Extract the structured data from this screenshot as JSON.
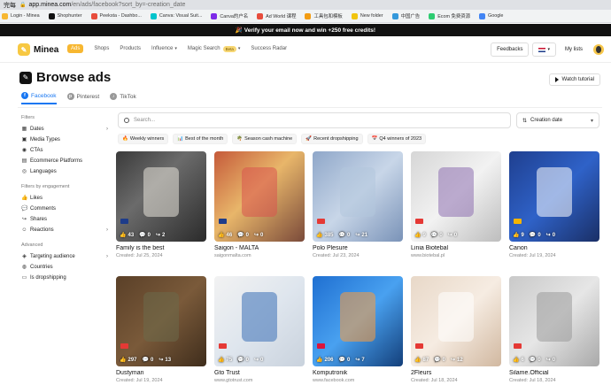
{
  "browser": {
    "tab_fragment": "完每",
    "url_host": "app.minea.com",
    "url_path": "/en/ads/facebook?sort_by=-creation_date",
    "bookmarks": [
      {
        "label": "Login - Minea",
        "color": "#f7b731"
      },
      {
        "label": "Shophunter",
        "color": "#111111"
      },
      {
        "label": "Peeksta - Dashbo...",
        "color": "#e74c3c"
      },
      {
        "label": "Canva: Visual Suit...",
        "color": "#00c4cc"
      },
      {
        "label": "Canva的户名",
        "color": "#7d2ae8"
      },
      {
        "label": "Ad World 课程",
        "color": "#e74c3c"
      },
      {
        "label": "工具包和模板",
        "color": "#f39c12"
      },
      {
        "label": "New folder",
        "color": "#f1c40f"
      },
      {
        "label": "中国广告",
        "color": "#3498db"
      },
      {
        "label": "Ecom 免费资源",
        "color": "#2ecc71"
      },
      {
        "label": "Google",
        "color": "#4285f4"
      }
    ]
  },
  "banner": {
    "text": "🎉 Verify your email now and win +250 free credits!"
  },
  "header": {
    "logo": "Minea",
    "nav": [
      {
        "label": "Ads",
        "active": true
      },
      {
        "label": "Shops"
      },
      {
        "label": "Products"
      },
      {
        "label": "Influence",
        "chevron": true
      },
      {
        "label": "Magic Search",
        "badge": "Beta",
        "chevron": true
      },
      {
        "label": "Success Radar"
      }
    ],
    "feedbacks": "Feedbacks",
    "my_lists": "My lists"
  },
  "page": {
    "title": "Browse ads",
    "watch_tutorial": "Watch tutorial",
    "tabs": [
      {
        "label": "Facebook",
        "active": true,
        "color": "#1877f2",
        "glyph": "f"
      },
      {
        "label": "Pinterest",
        "color": "#999999",
        "glyph": "p"
      },
      {
        "label": "TikTok",
        "color": "#999999",
        "glyph": "♪"
      }
    ]
  },
  "sidebar": {
    "filters_head": "Filters",
    "filters": [
      {
        "label": "Dates",
        "icon": "▦",
        "arrow": true
      },
      {
        "label": "Media Types",
        "icon": "▣"
      },
      {
        "label": "CTAs",
        "icon": "◉"
      },
      {
        "label": "Ecommerce Platforms",
        "icon": "▤"
      },
      {
        "label": "Languages",
        "icon": "◎"
      }
    ],
    "engagement_head": "Filters by engagement",
    "engagement": [
      {
        "label": "Likes",
        "icon": "👍"
      },
      {
        "label": "Comments",
        "icon": "💬"
      },
      {
        "label": "Shares",
        "icon": "↪"
      },
      {
        "label": "Reactions",
        "icon": "☺",
        "arrow": true
      }
    ],
    "advanced_head": "Advanced",
    "advanced": [
      {
        "label": "Targeting audience",
        "icon": "◈",
        "arrow": true
      },
      {
        "label": "Countries",
        "icon": "◍"
      },
      {
        "label": "Is dropshipping",
        "icon": "▭"
      }
    ]
  },
  "search": {
    "placeholder": "Search..."
  },
  "sort": {
    "label": "Creation date"
  },
  "chips": [
    {
      "label": "Weekly winners",
      "icon": "🔥"
    },
    {
      "label": "Best of the month",
      "icon": "📊"
    },
    {
      "label": "Season cash machine",
      "icon": "🌴"
    },
    {
      "label": "Recent dropshipping",
      "icon": "🚀"
    },
    {
      "label": "Q4 winners of 2023",
      "icon": "📅"
    }
  ],
  "cards": [
    {
      "title": "Family is the best",
      "sub": "Created: Jul 25, 2024",
      "likes": "43",
      "comments": "0",
      "shares": "2",
      "bg": "linear-gradient(135deg,#3a3a3a,#6b6b6b 40%,#2b2b2b)",
      "accent": "#e8e4da",
      "badge": "us"
    },
    {
      "title": "Saigon - MALTA",
      "sub": "saigonmalta.com",
      "likes": "46",
      "comments": "0",
      "shares": "0",
      "bg": "linear-gradient(135deg,#c55a3a,#e8b66a 45%,#7a4a3a)",
      "accent": "#d9534f",
      "badge": "us"
    },
    {
      "title": "Polo Plesure",
      "sub": "Created: Jul 23, 2024",
      "likes": "385",
      "comments": "0",
      "shares": "21",
      "bg": "linear-gradient(135deg,#8fa7c9,#c8d6e8 50%,#7a93b8)",
      "accent": "#b3c6dd",
      "badge": "yt"
    },
    {
      "title": "Linia Biotebal",
      "sub": "www.biotebal.pl",
      "likes": "9",
      "comments": "0",
      "shares": "0",
      "bg": "linear-gradient(135deg,#d6d6d6,#f2f2f2 50%,#bdbdbd)",
      "accent": "#8e6fb0",
      "badge": "yt"
    },
    {
      "title": "Canon",
      "sub": "Created: Jul 19, 2024",
      "likes": "9",
      "comments": "0",
      "shares": "0",
      "bg": "linear-gradient(135deg,#1f3f8f,#2f62c8 50%,#1a2f66)",
      "accent": "#ffffff",
      "badge": "es"
    },
    {
      "title": "Dustyman",
      "sub": "Created: Jul 19, 2024",
      "likes": "297",
      "comments": "0",
      "shares": "13",
      "bg": "linear-gradient(135deg,#5a4028,#7a5a3a 50%,#3f2d1c)",
      "accent": "#6b6a4a",
      "badge": "yt"
    },
    {
      "title": "Gto Trust",
      "sub": "www.gtotrust.com",
      "likes": "75",
      "comments": "0",
      "shares": "0",
      "bg": "linear-gradient(135deg,#f2f2f2,#dfe6ee 50%,#c9d2dd)",
      "accent": "#3b6fb6",
      "badge": "yt"
    },
    {
      "title": "Komputronik",
      "sub": "www.facebook.com",
      "likes": "206",
      "comments": "0",
      "shares": "7",
      "bg": "linear-gradient(135deg,#1f6fd1,#49a1f0 50%,#133f7a)",
      "accent": "#ff9c3a",
      "badge": "pl"
    },
    {
      "title": "2Fleurs",
      "sub": "Created: Jul 18, 2024",
      "likes": "87",
      "comments": "0",
      "shares": "12",
      "bg": "linear-gradient(135deg,#e8d8c8,#f6ece2 50%,#d1b8a0)",
      "accent": "#ffffff",
      "badge": "yt"
    },
    {
      "title": "Silame.Official",
      "sub": "Created: Jul 18, 2024",
      "likes": "6",
      "comments": "0",
      "shares": "0",
      "bg": "linear-gradient(135deg,#c9c9c9,#e6e6e6 50%,#a9a9a9)",
      "accent": "#9a9a9a",
      "badge": "yt"
    }
  ]
}
